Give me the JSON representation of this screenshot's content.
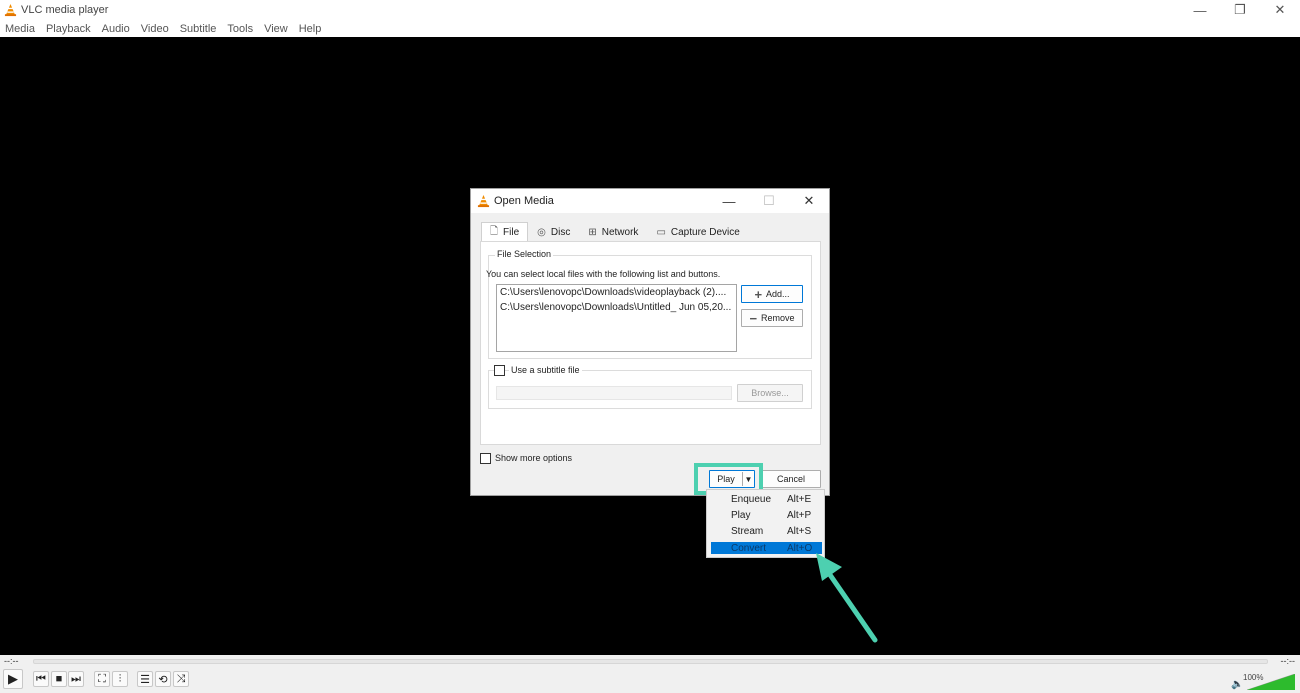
{
  "window": {
    "title": "VLC media player",
    "controls": {
      "minimize": "—",
      "restore": "❐",
      "close": "✕"
    }
  },
  "menu": [
    "Media",
    "Playback",
    "Audio",
    "Video",
    "Subtitle",
    "Tools",
    "View",
    "Help"
  ],
  "dialog": {
    "title": "Open Media",
    "tabs": [
      {
        "label": "File",
        "icon": "file-icon"
      },
      {
        "label": "Disc",
        "icon": "disc-icon"
      },
      {
        "label": "Network",
        "icon": "network-icon"
      },
      {
        "label": "Capture Device",
        "icon": "capture-device-icon"
      }
    ],
    "file_selection_label": "File Selection",
    "hint": "You can select local files with the following list and buttons.",
    "files": [
      "C:\\Users\\lenovopc\\Downloads\\videoplayback (2)....",
      "C:\\Users\\lenovopc\\Downloads\\Untitled_ Jun 05,20..."
    ],
    "add_label": "Add...",
    "remove_label": "Remove",
    "use_subtitle_label": "Use a subtitle file",
    "browse_label": "Browse...",
    "show_more_label": "Show more options",
    "play_label": "Play",
    "cancel_label": "Cancel"
  },
  "dropdown": [
    {
      "label": "Enqueue",
      "shortcut": "Alt+E"
    },
    {
      "label": "Play",
      "shortcut": "Alt+P"
    },
    {
      "label": "Stream",
      "shortcut": "Alt+S"
    },
    {
      "label": "Convert",
      "shortcut": "Alt+O"
    }
  ],
  "player": {
    "time_left": "--:--",
    "time_right": "--:--",
    "volume": "100%"
  },
  "colors": {
    "highlight": "#4dd0b0",
    "selection": "#0078d7",
    "volume": "#2dbb2d"
  }
}
